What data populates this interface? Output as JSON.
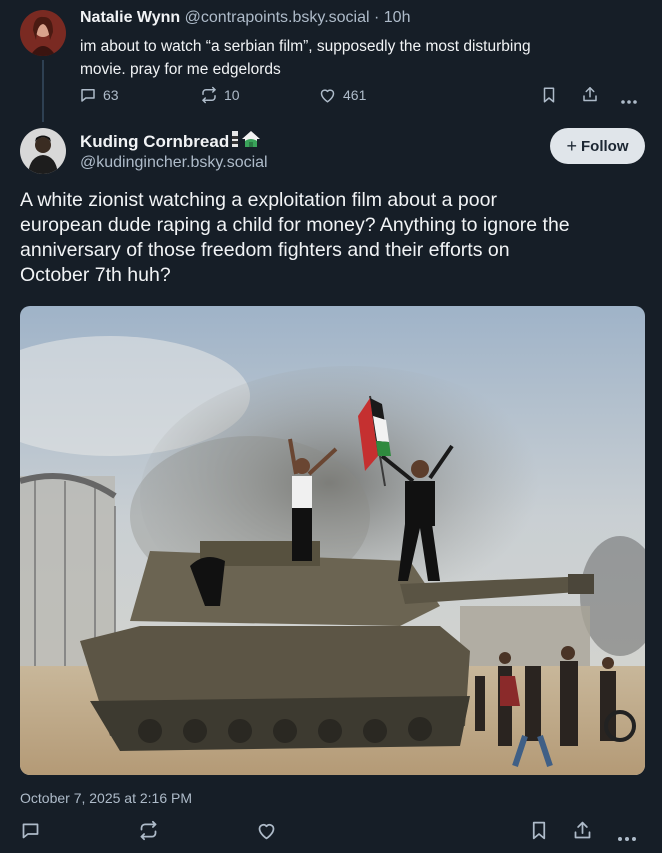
{
  "parent_post": {
    "author_name": "Natalie Wynn",
    "author_handle": "@contrapoints.bsky.social",
    "separator": "·",
    "time": "10h",
    "text_line1": "im about to watch “a serbian film”, supposedly the most disturbing",
    "text_line2": "movie. pray for me edgelords",
    "replies": "63",
    "reposts": "10",
    "likes": "461"
  },
  "main_post": {
    "author_name": "Kuding Cornbread",
    "author_handle": "@kudingincher.bsky.social",
    "follow_label": "Follow",
    "follow_plus": "+",
    "text_lines": [
      "A white zionist watching a exploitation film about a poor",
      "european dude raping a child for money? Anything to ignore the",
      "anniversary of those freedom fighters and their efforts on",
      "October 7th huh?"
    ],
    "timestamp": "October 7, 2025 at 2:16 PM"
  },
  "icons": {
    "reply": "reply-icon",
    "repost": "repost-icon",
    "like": "heart-icon",
    "bookmark": "bookmark-icon",
    "share": "share-icon",
    "more": "more-icon"
  },
  "colors": {
    "background": "#161e27",
    "muted": "#aebbc9",
    "text": "#f1f3f5"
  }
}
